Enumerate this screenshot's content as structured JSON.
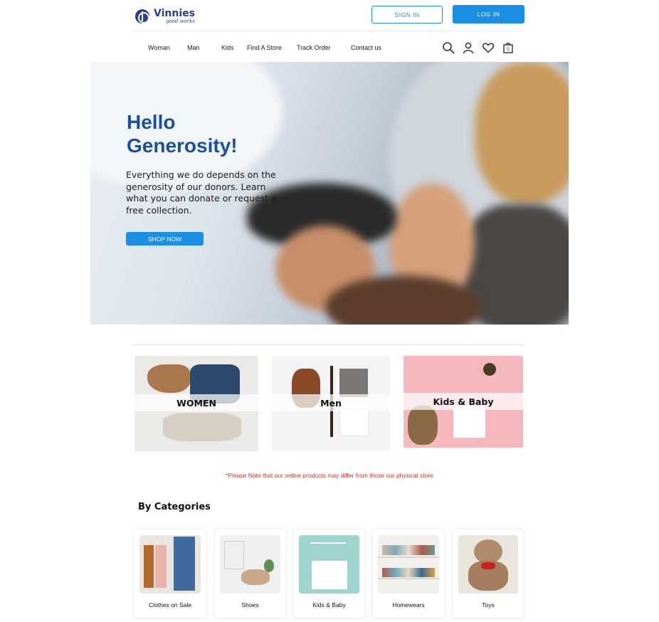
{
  "brand": {
    "name": "Vinnies",
    "tagline": "good works"
  },
  "header": {
    "signin_label": "SIGN IN",
    "login_label": "LOG IN"
  },
  "nav": {
    "items": [
      "Woman",
      "Man",
      "Kids",
      "Find A Store",
      "Track Order",
      "Contact us"
    ],
    "icons": [
      "search-icon",
      "user-icon",
      "heart-icon",
      "bag-icon"
    ],
    "bag_count": "0"
  },
  "hero": {
    "title_line1": "Hello",
    "title_line2": "Generosity!",
    "body": "Everything we do depends on the generosity of our donors. Learn what you can donate or request a free collection.",
    "cta_label": "SHOP NOW"
  },
  "featured": [
    {
      "label": "WOMEN"
    },
    {
      "label": "Men"
    },
    {
      "label": "Kids & Baby"
    }
  ],
  "notice": "*Please Note that our online products may differ from those our physical store",
  "categories": {
    "title": "By Categories",
    "items": [
      "Clothes on Sale",
      "Shoes",
      "Kids & Baby",
      "Homewears",
      "Toys"
    ]
  },
  "colors": {
    "accent": "#1a8fe3",
    "brand": "#2a3f8f",
    "hero_title": "#1a4fa0",
    "notice": "#d93025"
  }
}
